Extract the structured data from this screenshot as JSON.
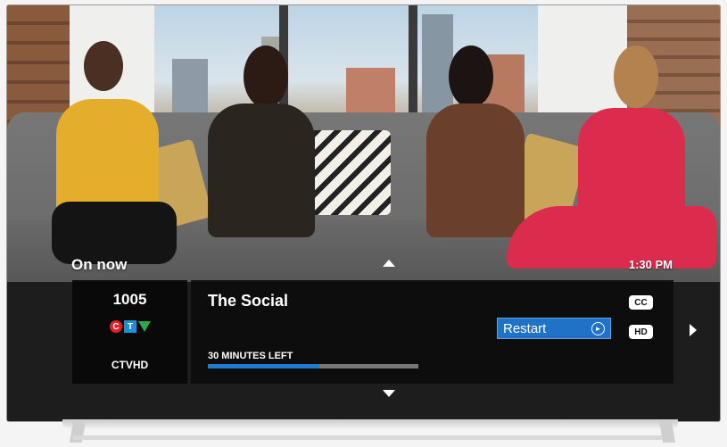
{
  "overlay": {
    "section_label": "On now",
    "clock": "1:30 PM"
  },
  "channel": {
    "number": "1005",
    "logo_letters": [
      "C",
      "T",
      "V"
    ],
    "call_sign": "CTVHD",
    "logo_colors": [
      "#e41e26",
      "#1e8fd6",
      "#2aa84a"
    ]
  },
  "program": {
    "title": "The Social",
    "time_left": "30 MINUTES LEFT",
    "progress_fraction": 0.53
  },
  "actions": {
    "restart_label": "Restart",
    "restart_icon": "replay-icon"
  },
  "badges": {
    "cc": "CC",
    "hd": "HD"
  },
  "navigation": {
    "up_icon": "arrow-up-icon",
    "down_icon": "arrow-down-icon",
    "right_icon": "arrow-right-icon"
  },
  "colors": {
    "accent": "#1f72c6",
    "progress": "#1f7bd1"
  }
}
